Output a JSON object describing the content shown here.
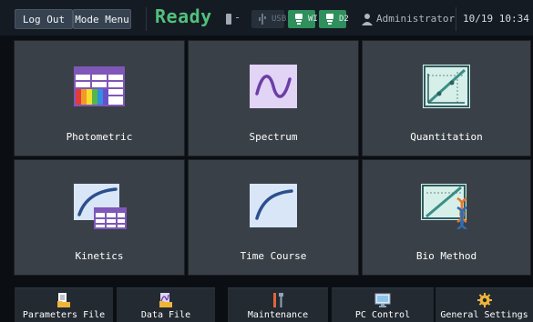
{
  "topbar": {
    "logout_label": "Log Out",
    "mode_label": "Mode Menu",
    "status_text": "Ready",
    "status_color": "#52c07d",
    "indicator_dash": "-",
    "chips": [
      {
        "label": "USB",
        "icon": "usb-icon",
        "active": false
      },
      {
        "label": "WI",
        "icon": "lamp-icon",
        "active": true
      },
      {
        "label": "D2",
        "icon": "lamp-icon",
        "active": true
      }
    ],
    "user_label": "Administrator",
    "datetime": "10/19 10:34"
  },
  "tiles": [
    {
      "label": "Photometric",
      "icon": "photometric-table-icon"
    },
    {
      "label": "Spectrum",
      "icon": "spectrum-wave-icon"
    },
    {
      "label": "Quantitation",
      "icon": "quantitation-graph-icon"
    },
    {
      "label": "Kinetics",
      "icon": "kinetics-curve-icon"
    },
    {
      "label": "Time Course",
      "icon": "time-course-curve-icon"
    },
    {
      "label": "Bio Method",
      "icon": "bio-method-dna-icon"
    }
  ],
  "bottomnav": [
    {
      "label": "Parameters File",
      "icon": "document-folder-icon"
    },
    {
      "label": "Data File",
      "icon": "chart-folder-icon"
    },
    {
      "label": "Maintenance",
      "icon": "tools-icon"
    },
    {
      "label": "PC Control",
      "icon": "monitor-icon"
    },
    {
      "label": "General Settings",
      "icon": "gear-icon"
    }
  ],
  "colors": {
    "accent_green": "#2f8f5d",
    "tile_bg": "#3a4047",
    "bar_bg": "#151b22"
  }
}
